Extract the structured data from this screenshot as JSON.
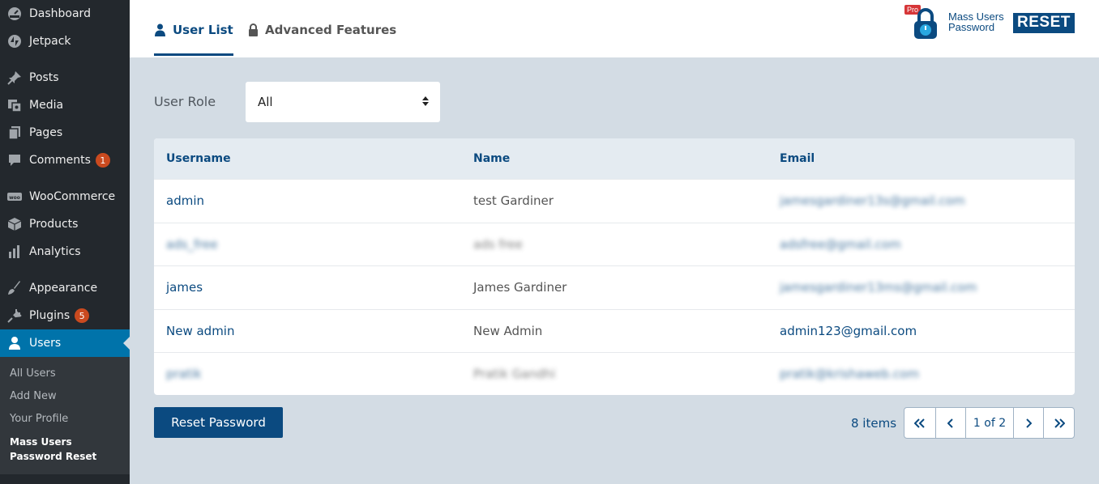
{
  "sidebar": {
    "items": [
      {
        "label": "Dashboard",
        "icon": "dashboard-icon"
      },
      {
        "label": "Jetpack",
        "icon": "jetpack-icon"
      },
      {
        "label": "Posts",
        "icon": "pin-icon"
      },
      {
        "label": "Media",
        "icon": "media-icon"
      },
      {
        "label": "Pages",
        "icon": "pages-icon"
      },
      {
        "label": "Comments",
        "icon": "comment-icon",
        "badge": "1"
      },
      {
        "label": "WooCommerce",
        "icon": "woo-icon"
      },
      {
        "label": "Products",
        "icon": "box-icon"
      },
      {
        "label": "Analytics",
        "icon": "bar-chart-icon"
      },
      {
        "label": "Appearance",
        "icon": "brush-icon"
      },
      {
        "label": "Plugins",
        "icon": "plug-icon",
        "badge": "5"
      },
      {
        "label": "Users",
        "icon": "user-icon"
      }
    ],
    "submenu": [
      "All Users",
      "Add New",
      "Your Profile",
      "Mass Users Password Reset"
    ]
  },
  "header": {
    "tabs": [
      {
        "label": "User List",
        "icon": "user-icon",
        "active": true
      },
      {
        "label": "Advanced Features",
        "icon": "lock-icon",
        "active": false
      }
    ],
    "logo": {
      "pro": "Pro",
      "line1": "Mass Users",
      "line2": "Password",
      "reset": "RESET"
    }
  },
  "filter": {
    "label": "User Role",
    "selected": "All"
  },
  "table": {
    "columns": [
      "Username",
      "Name",
      "Email"
    ],
    "rows": [
      {
        "username": "admin",
        "name": "test Gardiner",
        "email": "jamesgardiner13s@gmail.com",
        "blur_user": false,
        "blur_name": false,
        "blur_email": true
      },
      {
        "username": "ads_free",
        "name": "ads free",
        "email": "adsfree@gmail.com",
        "blur_user": true,
        "blur_name": true,
        "blur_email": true
      },
      {
        "username": "james",
        "name": "James Gardiner",
        "email": "jamesgardiner13ms@gmail.com",
        "blur_user": false,
        "blur_name": false,
        "blur_email": true
      },
      {
        "username": "New admin",
        "name": "New Admin",
        "email": "admin123@gmail.com",
        "blur_user": false,
        "blur_name": false,
        "blur_email": false
      },
      {
        "username": "pratik",
        "name": "Pratik Gandhi",
        "email": "pratik@krishaweb.com",
        "blur_user": true,
        "blur_name": true,
        "blur_email": true
      }
    ]
  },
  "footer": {
    "reset_button": "Reset Password",
    "items_count": "8 items",
    "pager": {
      "first": "«",
      "prev": "‹",
      "current": "1 of 2",
      "next": "›",
      "last": "»"
    }
  },
  "colors": {
    "accent": "#0b4a80",
    "sidebar_bg": "#23282d",
    "active_menu": "#0073aa",
    "badge": "#ca4a1f",
    "content_bg": "#d3dce4"
  }
}
